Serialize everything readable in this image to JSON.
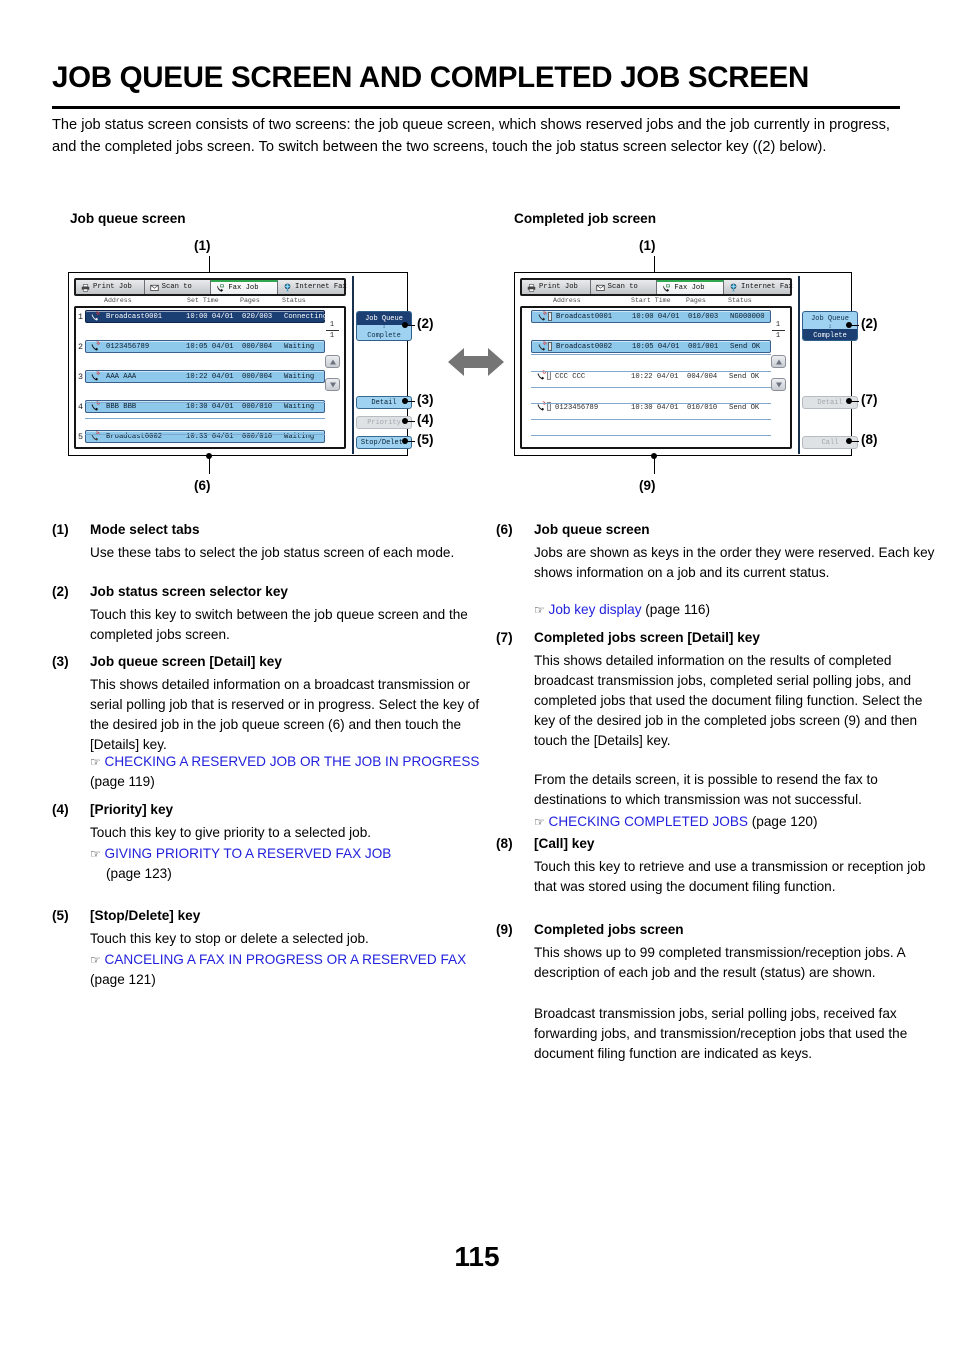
{
  "document": {
    "title": "JOB QUEUE SCREEN AND COMPLETED JOB SCREEN",
    "intro": "The job status screen consists of two screens: the job queue screen, which shows reserved jobs and the job currently in progress, and the completed jobs screen. To switch between the two screens, touch the job status screen selector key ((2) below).",
    "page_number": "115"
  },
  "figures": {
    "left_caption": "Job queue screen",
    "right_caption": "Completed job screen",
    "callouts": {
      "c1": "(1)",
      "c2": "(2)",
      "c3": "(3)",
      "c4": "(4)",
      "c5": "(5)",
      "c6": "(6)",
      "c7": "(7)",
      "c8": "(8)",
      "c9": "(9)"
    }
  },
  "tabs": [
    {
      "label": "Print Job",
      "icon": "printer-icon",
      "active": false
    },
    {
      "label": "Scan to",
      "icon": "scan-icon",
      "active": false
    },
    {
      "label": "Fax Job",
      "icon": "fax-icon",
      "active": true
    },
    {
      "label": "Internet Fax",
      "icon": "internet-fax-icon",
      "active": false
    }
  ],
  "job_queue_screen": {
    "columns": [
      "Address",
      "Set Time",
      "Pages",
      "Status"
    ],
    "page_indicator": {
      "current": "1",
      "total": "1"
    },
    "rows": [
      {
        "num": "1",
        "icon": "broadcast-icon",
        "address": "Broadcast0001",
        "time": "10:00 04/01",
        "pages": "020/003",
        "status": "Connecting",
        "selected": true
      },
      {
        "num": "2",
        "icon": "fax-send-icon",
        "address": "0123456789",
        "time": "10:05 04/01",
        "pages": "000/004",
        "status": "Waiting",
        "selected": false
      },
      {
        "num": "3",
        "icon": "fax-send-icon",
        "address": "AAA AAA",
        "time": "10:22 04/01",
        "pages": "000/004",
        "status": "Waiting",
        "selected": false
      },
      {
        "num": "4",
        "icon": "fax-send-icon",
        "address": "BBB BBB",
        "time": "10:30 04/01",
        "pages": "000/010",
        "status": "Waiting",
        "selected": false
      },
      {
        "num": "5",
        "icon": "broadcast-icon",
        "address": "Broadcast0002",
        "time": "10:33 04/01",
        "pages": "000/010",
        "status": "Waiting",
        "selected": false
      }
    ],
    "selector": {
      "top_label": "Job Queue",
      "bottom_label": "Complete",
      "active": "top"
    },
    "buttons": [
      {
        "label": "Detail",
        "disabled": false
      },
      {
        "label": "Priority",
        "disabled": true
      },
      {
        "label": "Stop/Delete",
        "disabled": false
      }
    ]
  },
  "completed_job_screen": {
    "columns": [
      "Address",
      "Start Time",
      "Pages",
      "Status"
    ],
    "page_indicator": {
      "current": "1",
      "total": "1"
    },
    "rows": [
      {
        "icon": "broadcast-icon",
        "address": "Broadcast0001",
        "time": "10:00 04/01",
        "pages": "010/003",
        "status": "NG000000",
        "selected": true
      },
      {
        "icon": "broadcast-icon",
        "address": "Broadcast0002",
        "time": "10:05 04/01",
        "pages": "001/001",
        "status": "Send OK",
        "selected": true
      },
      {
        "icon": "fax-send-icon",
        "address": "CCC CCC",
        "time": "10:22 04/01",
        "pages": "004/004",
        "status": "Send OK",
        "selected": false
      },
      {
        "icon": "fax-send-icon",
        "address": "0123456789",
        "time": "10:30 04/01",
        "pages": "010/010",
        "status": "Send OK",
        "selected": false
      }
    ],
    "selector": {
      "top_label": "Job Queue",
      "bottom_label": "Complete",
      "active": "bottom"
    },
    "buttons": [
      {
        "label": "Detail",
        "disabled": true
      },
      {
        "label": "Call",
        "disabled": true
      }
    ]
  },
  "legend_left": [
    {
      "num": "(1)",
      "heading": "Mode select tabs",
      "body": "Use these tabs to select the job status screen of each mode."
    },
    {
      "num": "(2)",
      "heading": "Job status screen selector key",
      "body": "Touch this key to switch between the job queue screen and the completed jobs screen."
    },
    {
      "num": "(3)",
      "heading": "Job queue screen [Detail] key",
      "body": "This shows detailed information on a broadcast transmission or serial polling job that is reserved or in progress. Select the key of the desired job in the job queue screen (6) and then touch the [Details] key.",
      "ref_link": "CHECKING A RESERVED JOB OR THE JOB IN PROGRESS",
      "ref_page": "(page 119)"
    },
    {
      "num": "(4)",
      "heading": "[Priority] key",
      "body": "Touch this key to give priority to a selected job.",
      "ref_link": "GIVING PRIORITY TO A RESERVED FAX JOB",
      "ref_page": "(page 123)"
    },
    {
      "num": "(5)",
      "heading": "[Stop/Delete] key",
      "body": "Touch this key to stop or delete a selected job.",
      "ref_link": "CANCELING A FAX IN PROGRESS OR A RESERVED FAX",
      "ref_page": "(page 121)"
    }
  ],
  "legend_right": [
    {
      "num": "(6)",
      "heading": "Job queue screen",
      "body": "Jobs are shown as keys in the order they were reserved. Each key shows information on a job and its current status.",
      "ref_link": "Job key display",
      "ref_page": "(page 116)"
    },
    {
      "num": "(7)",
      "heading": "Completed jobs screen [Detail] key",
      "body": "This shows detailed information on the results of completed broadcast transmission jobs, completed serial polling jobs, and completed jobs that used the document filing function. Select the key of the desired job in the completed jobs screen (9) and then touch the [Details] key.",
      "body2": "From the details screen, it is possible to resend the fax to destinations to which transmission was not successful.",
      "ref_link": "CHECKING COMPLETED JOBS",
      "ref_page": "(page 120)"
    },
    {
      "num": "(8)",
      "heading": "[Call] key",
      "body": "Touch this key to retrieve and use a transmission or reception job that was stored using the document filing function."
    },
    {
      "num": "(9)",
      "heading": "Completed jobs screen",
      "body": "This shows up to 99 completed transmission/reception jobs. A description of each job and the result (status) are shown.",
      "body2": "Broadcast transmission jobs, serial polling jobs, received fax forwarding jobs, and transmission/reception jobs that used the document filing function are indicated as keys."
    }
  ],
  "colors": {
    "link": "#2222dd",
    "selected_row": "#1b3e73",
    "row": "#8ec8ea",
    "key": "#9ed2f0",
    "disabled_key": "#dfe2e5"
  }
}
